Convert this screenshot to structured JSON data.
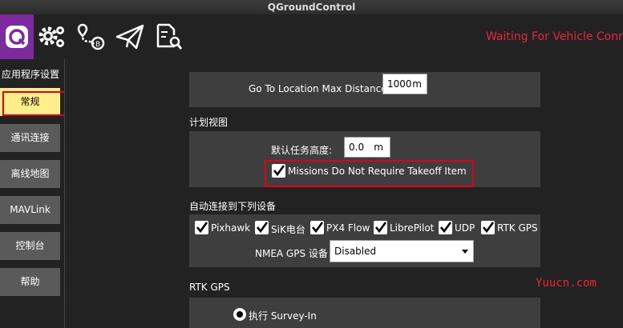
{
  "window": {
    "title": "QGroundControl"
  },
  "toolbar": {
    "icons": [
      "qgc-logo-icon",
      "settings-gears-icon",
      "plan-route-icon",
      "fly-paper-plane-icon",
      "analyze-document-icon"
    ],
    "status": "Waiting For Vehicle Conn"
  },
  "sidebar": {
    "title": "应用程序设置",
    "items": [
      {
        "label": "常规",
        "active": true
      },
      {
        "label": "通讯连接",
        "active": false
      },
      {
        "label": "离线地图",
        "active": false
      },
      {
        "label": "MAVLink",
        "active": false
      },
      {
        "label": "控制台",
        "active": false
      },
      {
        "label": "帮助",
        "active": false
      }
    ]
  },
  "main": {
    "goto": {
      "label": "Go To Location Max Distance",
      "value": "1000",
      "unit": "m"
    },
    "plan_view": {
      "heading": "计划视图",
      "altitude_label": "默认任务高度:",
      "altitude_value": "0.0",
      "altitude_unit": "m",
      "takeoff_label": "Missions Do Not Require Takeoff Item",
      "takeoff_checked": true
    },
    "autoconnect": {
      "heading": "自动连接到下列设备",
      "devices": [
        {
          "label": "Pixhawk",
          "checked": true
        },
        {
          "label": "SiK电台",
          "checked": true
        },
        {
          "label": "PX4 Flow",
          "checked": true
        },
        {
          "label": "LibrePilot",
          "checked": true
        },
        {
          "label": "UDP",
          "checked": true
        },
        {
          "label": "RTK GPS",
          "checked": true
        }
      ],
      "nmea_label": "NMEA GPS 设备",
      "nmea_value": "Disabled"
    },
    "rtk": {
      "heading": "RTK GPS",
      "option_label": "执行 Survey-In"
    }
  },
  "watermark": "Yuucn.com",
  "colors": {
    "accent": "#7c2a9e",
    "active_tab": "#ffef8a",
    "status_red": "#e8263a",
    "highlight_box": "#e4001b"
  }
}
